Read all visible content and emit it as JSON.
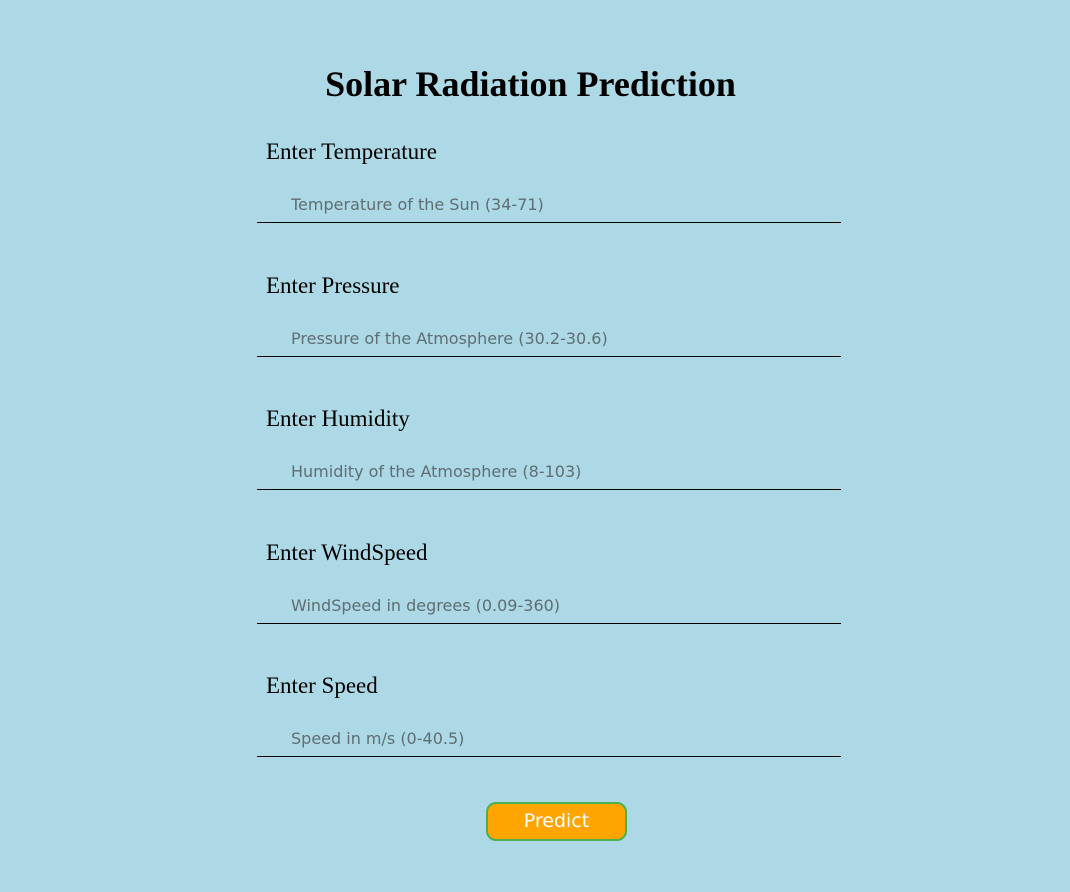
{
  "page": {
    "title": "Solar Radiation Prediction"
  },
  "fields": [
    {
      "label": "Enter Temperature",
      "placeholder": "Temperature of the Sun (34-71)",
      "value": ""
    },
    {
      "label": "Enter Pressure",
      "placeholder": "Pressure of the Atmosphere (30.2-30.6)",
      "value": ""
    },
    {
      "label": "Enter Humidity",
      "placeholder": "Humidity of the Atmosphere (8-103)",
      "value": ""
    },
    {
      "label": "Enter WindSpeed",
      "placeholder": "WindSpeed in degrees (0.09-360)",
      "value": ""
    },
    {
      "label": "Enter Speed",
      "placeholder": "Speed in m/s (0-40.5)",
      "value": ""
    }
  ],
  "actions": {
    "predict_label": "Predict"
  },
  "colors": {
    "background": "#add8e6",
    "button_fill": "#ffa500",
    "button_border": "#4caf50",
    "button_text": "#ffffff"
  }
}
